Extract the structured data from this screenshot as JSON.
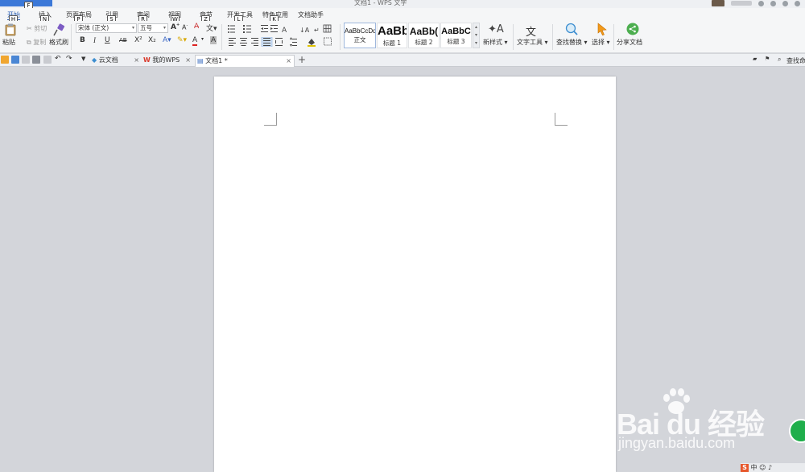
{
  "window": {
    "title": "文档1 - WPS 文字",
    "keytip_app": "F"
  },
  "ribbon_tabs": [
    {
      "label": "开始",
      "keytip": "H"
    },
    {
      "label": "插入",
      "keytip": "N"
    },
    {
      "label": "页面布局",
      "keytip": "P"
    },
    {
      "label": "引用",
      "keytip": "S"
    },
    {
      "label": "审阅",
      "keytip": "R"
    },
    {
      "label": "视图",
      "keytip": "W"
    },
    {
      "label": "章节",
      "keytip": "Z"
    },
    {
      "label": "开发工具",
      "keytip": "L"
    },
    {
      "label": "特色应用",
      "keytip": "K"
    },
    {
      "label": "文档助手",
      "keytip": ""
    }
  ],
  "clipboard": {
    "paste": "粘贴",
    "cut": "剪切",
    "copy": "复制",
    "format_painter": "格式刷"
  },
  "font": {
    "name": "宋体 (正文)",
    "size": "五号",
    "bold": "B",
    "italic": "I",
    "underline": "U",
    "strike": "AB",
    "superscript": "X²",
    "subscript": "X₂"
  },
  "styles": [
    {
      "sample": "AaBbCcDd",
      "name": "正文"
    },
    {
      "sample": "AaBb",
      "name": "标题 1"
    },
    {
      "sample": "AaBb(",
      "name": "标题 2"
    },
    {
      "sample": "AaBbC",
      "name": "标题 3"
    }
  ],
  "tools": {
    "new_style": "新样式",
    "text_tools": "文字工具",
    "find_replace": "查找替换",
    "select": "选择",
    "share": "分享文档"
  },
  "doc_tabs": [
    {
      "label": "云文档"
    },
    {
      "label": "我的WPS"
    },
    {
      "label": "文档1 *"
    }
  ],
  "search_label": "查找命",
  "watermark": {
    "brand": "Bai du 经验",
    "url": "jingyan.baidu.com"
  },
  "tray_text": "中",
  "colors": {
    "accent": "#2b5fb4",
    "app_menu": "#3b78d8",
    "workspace": "#d3d5da",
    "share_green": "#4cae4f"
  }
}
